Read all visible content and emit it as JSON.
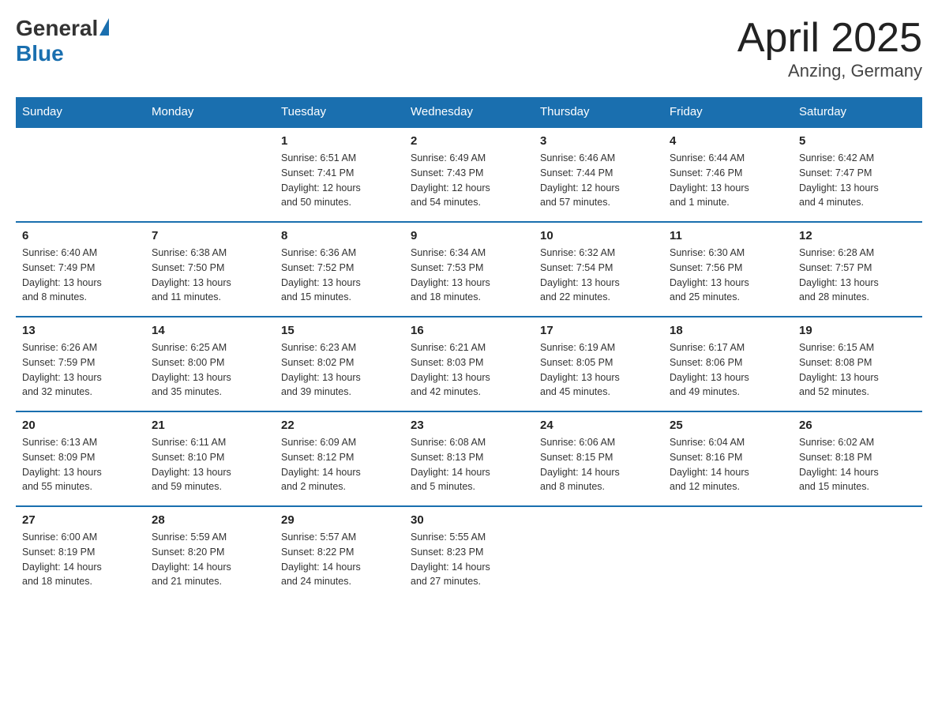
{
  "header": {
    "logo_general": "General",
    "logo_blue": "Blue",
    "title": "April 2025",
    "subtitle": "Anzing, Germany"
  },
  "days_of_week": [
    "Sunday",
    "Monday",
    "Tuesday",
    "Wednesday",
    "Thursday",
    "Friday",
    "Saturday"
  ],
  "weeks": [
    [
      {
        "num": "",
        "info": ""
      },
      {
        "num": "",
        "info": ""
      },
      {
        "num": "1",
        "info": "Sunrise: 6:51 AM\nSunset: 7:41 PM\nDaylight: 12 hours\nand 50 minutes."
      },
      {
        "num": "2",
        "info": "Sunrise: 6:49 AM\nSunset: 7:43 PM\nDaylight: 12 hours\nand 54 minutes."
      },
      {
        "num": "3",
        "info": "Sunrise: 6:46 AM\nSunset: 7:44 PM\nDaylight: 12 hours\nand 57 minutes."
      },
      {
        "num": "4",
        "info": "Sunrise: 6:44 AM\nSunset: 7:46 PM\nDaylight: 13 hours\nand 1 minute."
      },
      {
        "num": "5",
        "info": "Sunrise: 6:42 AM\nSunset: 7:47 PM\nDaylight: 13 hours\nand 4 minutes."
      }
    ],
    [
      {
        "num": "6",
        "info": "Sunrise: 6:40 AM\nSunset: 7:49 PM\nDaylight: 13 hours\nand 8 minutes."
      },
      {
        "num": "7",
        "info": "Sunrise: 6:38 AM\nSunset: 7:50 PM\nDaylight: 13 hours\nand 11 minutes."
      },
      {
        "num": "8",
        "info": "Sunrise: 6:36 AM\nSunset: 7:52 PM\nDaylight: 13 hours\nand 15 minutes."
      },
      {
        "num": "9",
        "info": "Sunrise: 6:34 AM\nSunset: 7:53 PM\nDaylight: 13 hours\nand 18 minutes."
      },
      {
        "num": "10",
        "info": "Sunrise: 6:32 AM\nSunset: 7:54 PM\nDaylight: 13 hours\nand 22 minutes."
      },
      {
        "num": "11",
        "info": "Sunrise: 6:30 AM\nSunset: 7:56 PM\nDaylight: 13 hours\nand 25 minutes."
      },
      {
        "num": "12",
        "info": "Sunrise: 6:28 AM\nSunset: 7:57 PM\nDaylight: 13 hours\nand 28 minutes."
      }
    ],
    [
      {
        "num": "13",
        "info": "Sunrise: 6:26 AM\nSunset: 7:59 PM\nDaylight: 13 hours\nand 32 minutes."
      },
      {
        "num": "14",
        "info": "Sunrise: 6:25 AM\nSunset: 8:00 PM\nDaylight: 13 hours\nand 35 minutes."
      },
      {
        "num": "15",
        "info": "Sunrise: 6:23 AM\nSunset: 8:02 PM\nDaylight: 13 hours\nand 39 minutes."
      },
      {
        "num": "16",
        "info": "Sunrise: 6:21 AM\nSunset: 8:03 PM\nDaylight: 13 hours\nand 42 minutes."
      },
      {
        "num": "17",
        "info": "Sunrise: 6:19 AM\nSunset: 8:05 PM\nDaylight: 13 hours\nand 45 minutes."
      },
      {
        "num": "18",
        "info": "Sunrise: 6:17 AM\nSunset: 8:06 PM\nDaylight: 13 hours\nand 49 minutes."
      },
      {
        "num": "19",
        "info": "Sunrise: 6:15 AM\nSunset: 8:08 PM\nDaylight: 13 hours\nand 52 minutes."
      }
    ],
    [
      {
        "num": "20",
        "info": "Sunrise: 6:13 AM\nSunset: 8:09 PM\nDaylight: 13 hours\nand 55 minutes."
      },
      {
        "num": "21",
        "info": "Sunrise: 6:11 AM\nSunset: 8:10 PM\nDaylight: 13 hours\nand 59 minutes."
      },
      {
        "num": "22",
        "info": "Sunrise: 6:09 AM\nSunset: 8:12 PM\nDaylight: 14 hours\nand 2 minutes."
      },
      {
        "num": "23",
        "info": "Sunrise: 6:08 AM\nSunset: 8:13 PM\nDaylight: 14 hours\nand 5 minutes."
      },
      {
        "num": "24",
        "info": "Sunrise: 6:06 AM\nSunset: 8:15 PM\nDaylight: 14 hours\nand 8 minutes."
      },
      {
        "num": "25",
        "info": "Sunrise: 6:04 AM\nSunset: 8:16 PM\nDaylight: 14 hours\nand 12 minutes."
      },
      {
        "num": "26",
        "info": "Sunrise: 6:02 AM\nSunset: 8:18 PM\nDaylight: 14 hours\nand 15 minutes."
      }
    ],
    [
      {
        "num": "27",
        "info": "Sunrise: 6:00 AM\nSunset: 8:19 PM\nDaylight: 14 hours\nand 18 minutes."
      },
      {
        "num": "28",
        "info": "Sunrise: 5:59 AM\nSunset: 8:20 PM\nDaylight: 14 hours\nand 21 minutes."
      },
      {
        "num": "29",
        "info": "Sunrise: 5:57 AM\nSunset: 8:22 PM\nDaylight: 14 hours\nand 24 minutes."
      },
      {
        "num": "30",
        "info": "Sunrise: 5:55 AM\nSunset: 8:23 PM\nDaylight: 14 hours\nand 27 minutes."
      },
      {
        "num": "",
        "info": ""
      },
      {
        "num": "",
        "info": ""
      },
      {
        "num": "",
        "info": ""
      }
    ]
  ]
}
